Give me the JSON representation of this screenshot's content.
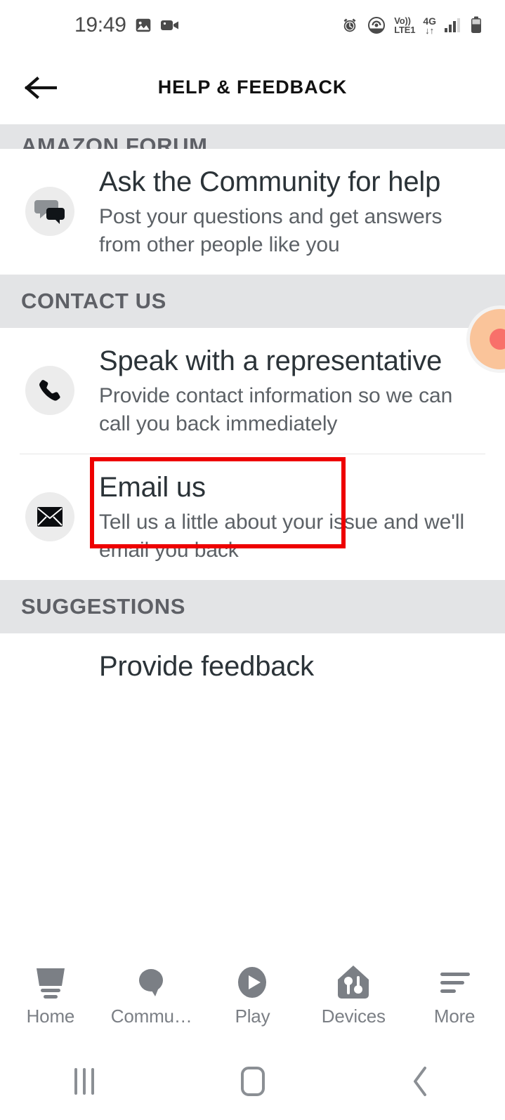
{
  "status_bar": {
    "time": "19:49",
    "left_icons": [
      "image-icon",
      "video-camera-icon"
    ],
    "right_icons": [
      "alarm-icon",
      "hotspot-icon",
      "volte-icon",
      "signal-bars-icon",
      "battery-icon"
    ],
    "volte_top": "Vo))",
    "volte_bottom": "LTE1",
    "network_type": "4G",
    "network_arrows": "↓↑"
  },
  "app_bar": {
    "back_icon": "back-arrow-icon",
    "title": "HELP & FEEDBACK"
  },
  "sections": [
    {
      "header": "AMAZON FORUM",
      "clipped": true,
      "rows": [
        {
          "icon": "chat-bubbles-icon",
          "title": "Ask the Community for help",
          "desc": "Post your questions and get answers from other people like you"
        }
      ]
    },
    {
      "header": "CONTACT US",
      "clipped": false,
      "rows": [
        {
          "icon": "phone-icon",
          "title": "Speak with a representative",
          "desc": "Provide contact information so we can call you back immediately",
          "highlighted": true
        },
        {
          "icon": "envelope-icon",
          "title": "Email us",
          "desc": "Tell us a little about your issue and we'll email you back"
        }
      ]
    },
    {
      "header": "SUGGESTIONS",
      "clipped": false,
      "rows": [
        {
          "icon": "",
          "title": "Provide feedback",
          "desc": ""
        }
      ]
    }
  ],
  "tab_bar": {
    "tabs": [
      {
        "label": "Home",
        "icon": "basket-icon"
      },
      {
        "label": "Commu…",
        "icon": "speech-bubble-icon"
      },
      {
        "label": "Play",
        "icon": "play-circle-icon"
      },
      {
        "label": "Devices",
        "icon": "house-devices-icon"
      },
      {
        "label": "More",
        "icon": "hamburger-menu-icon"
      }
    ]
  },
  "nav_bar": {
    "recents_label": "recents-icon",
    "home_label": "home-square-icon",
    "back_label": "back-chevron-icon"
  },
  "colors": {
    "section_header_bg": "#e3e4e6",
    "section_header_text": "#5e6066",
    "title_text": "#2b3338",
    "desc_text": "#5c6166",
    "annotation": "#ee0000",
    "tab_inactive": "#7b7f85",
    "touch_blob": "#fac49a",
    "touch_dot": "#f8706a"
  }
}
